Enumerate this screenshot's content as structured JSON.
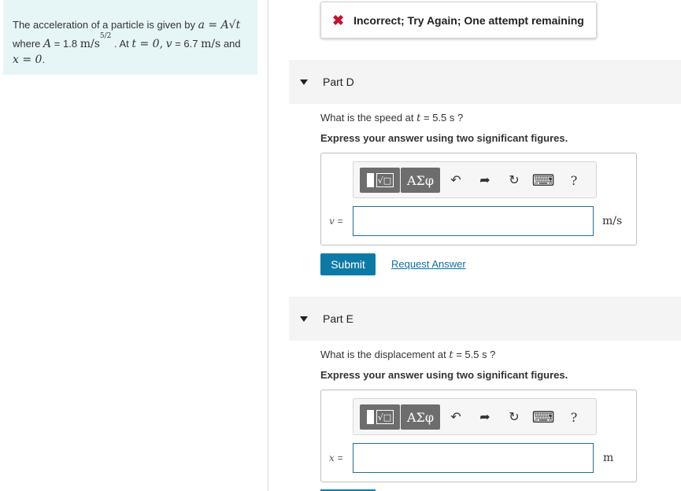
{
  "problem": {
    "line1_text": "The acceleration of a particle is given by",
    "formula_a": "a = A√t",
    "line2_where": "where",
    "A_label": "A",
    "A_value": "= 1.8",
    "A_unit": "m/s",
    "A_exponent": "5/2",
    "at_text": ". At",
    "t_zero": "t = 0,",
    "v_label": "v",
    "v_value": "= 6.7",
    "v_unit": "m/s",
    "and_text": "and",
    "x_zero": "x = 0",
    "period": "."
  },
  "banner": {
    "icon": "x-icon",
    "text": "Incorrect; Try Again; One attempt remaining"
  },
  "toolbar": {
    "templates_radical": "√□",
    "symbols_label": "ΑΣφ",
    "undo_icon": "↶",
    "redo_icon": "➦",
    "reset_icon": "↻",
    "keyboard_icon": "⌨",
    "help_label": "?"
  },
  "partD": {
    "title": "Part D",
    "question_prefix": "What is the speed at",
    "question_var": "t",
    "question_suffix": "= 5.5 s ?",
    "instruction": "Express your answer using two significant figures.",
    "var_label": "v",
    "var_eq": "=",
    "input_value": "",
    "unit": "m/s",
    "submit_label": "Submit",
    "request_label": "Request Answer"
  },
  "partE": {
    "title": "Part E",
    "question_prefix": "What is the displacement at",
    "question_var": "t",
    "question_suffix": "= 5.5 s ?",
    "instruction": "Express your answer using two significant figures.",
    "var_label": "x",
    "var_eq": "=",
    "input_value": "",
    "unit": "m"
  }
}
